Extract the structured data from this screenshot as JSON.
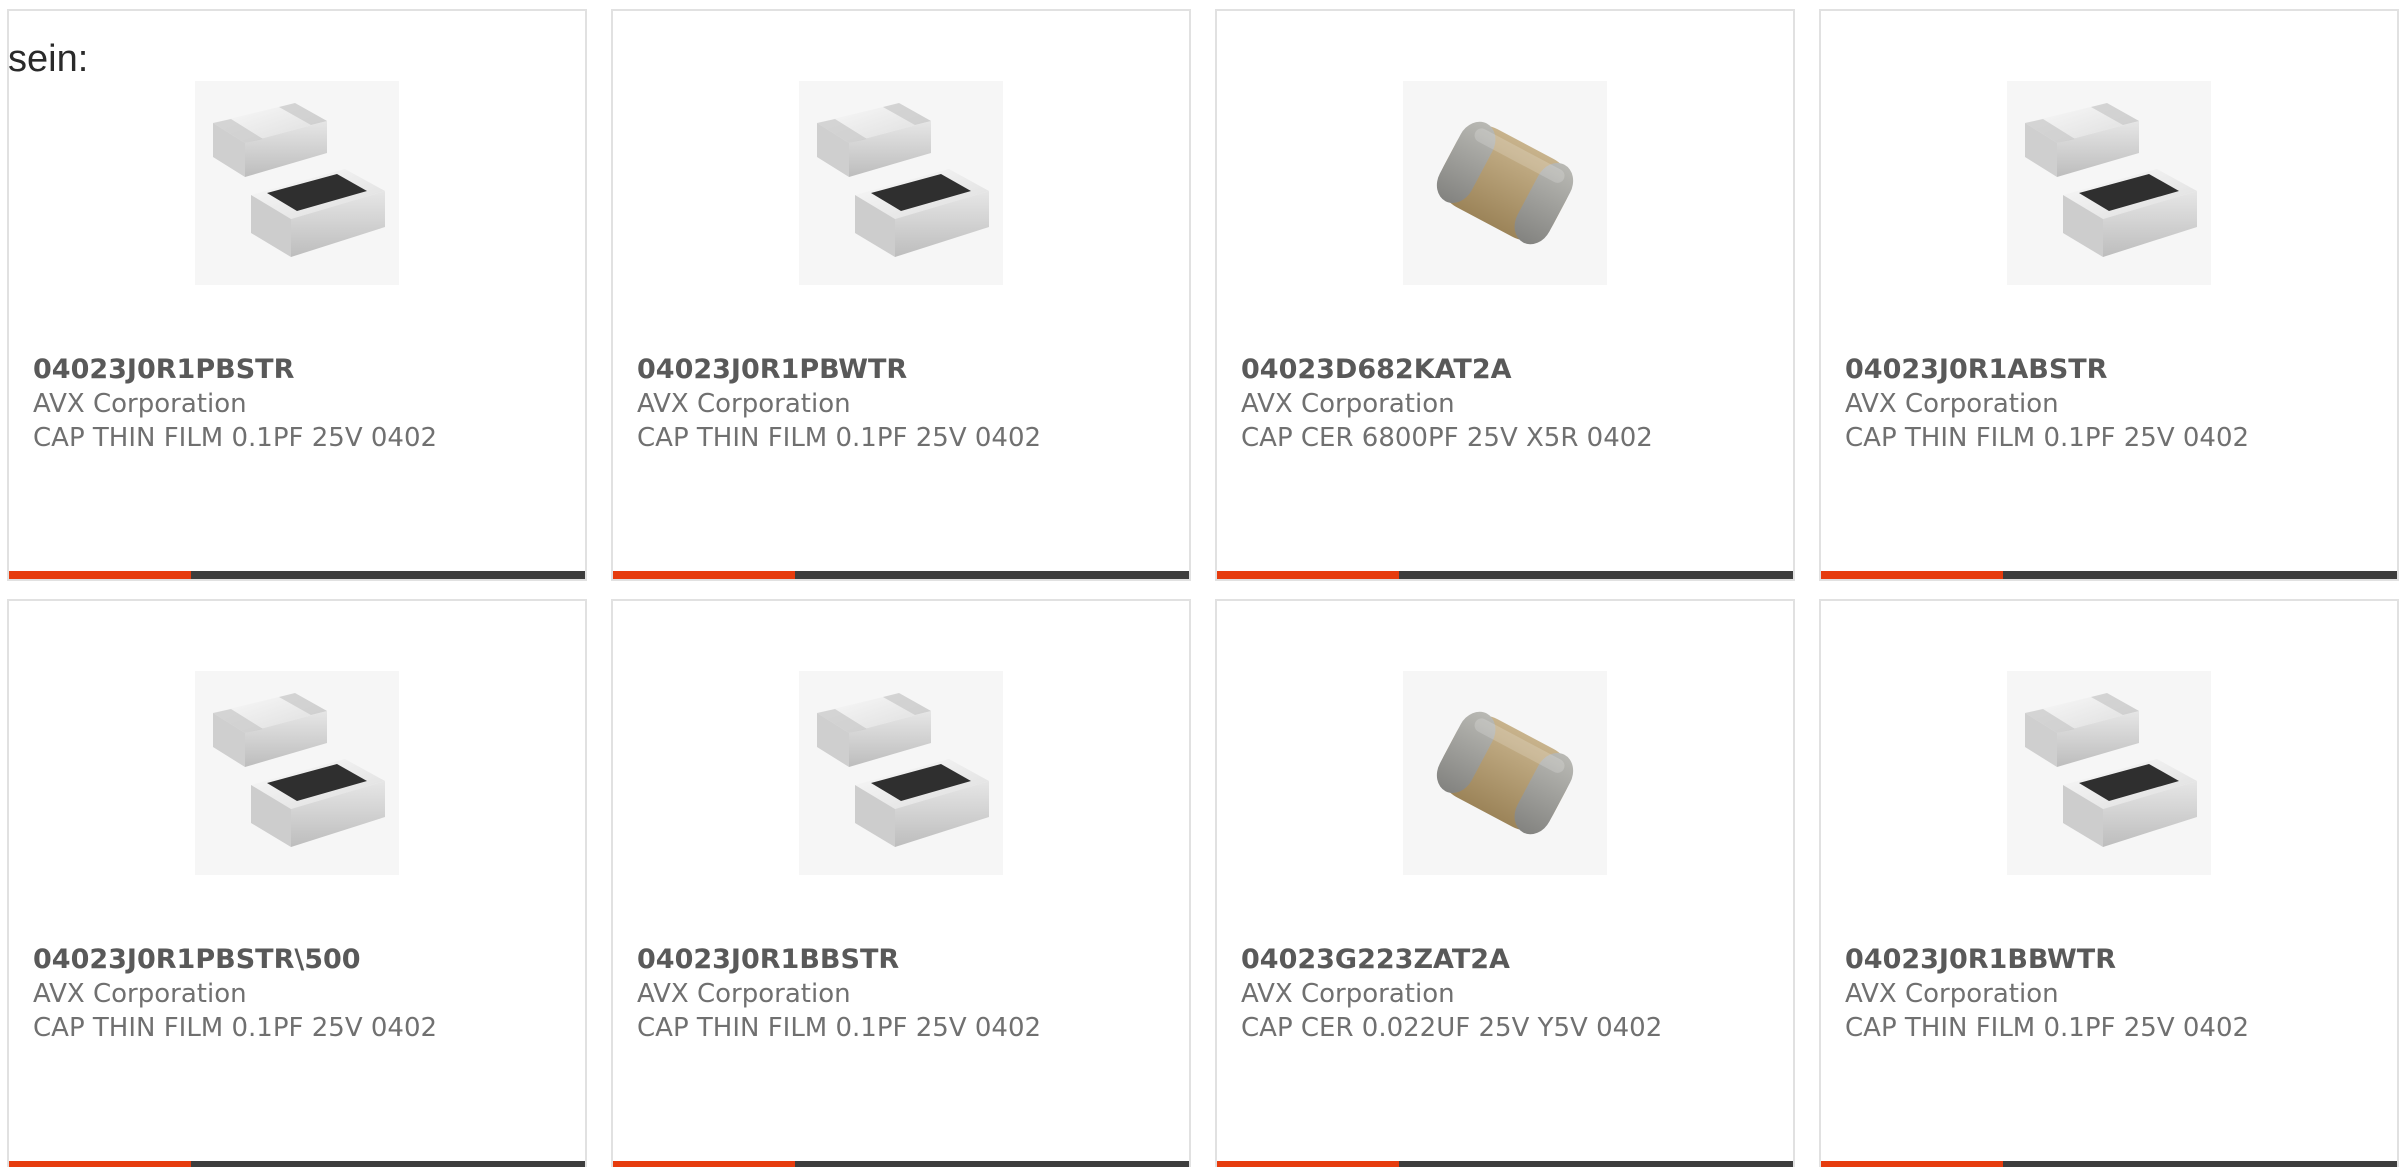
{
  "lead_text": "sein:",
  "colors": {
    "accent": "#e63c0e",
    "bar": "#3d3d3d",
    "border": "#e1e1e1"
  },
  "products": [
    {
      "part_number": "04023J0R1PBSTR",
      "manufacturer": "AVX Corporation",
      "description": "CAP THIN FILM 0.1PF 25V 0402",
      "image": "thin-film-capacitor-image"
    },
    {
      "part_number": "04023J0R1PBWTR",
      "manufacturer": "AVX Corporation",
      "description": "CAP THIN FILM 0.1PF 25V 0402",
      "image": "thin-film-capacitor-image"
    },
    {
      "part_number": "04023D682KAT2A",
      "manufacturer": "AVX Corporation",
      "description": "CAP CER 6800PF 25V X5R 0402",
      "image": "ceramic-capacitor-image"
    },
    {
      "part_number": "04023J0R1ABSTR",
      "manufacturer": "AVX Corporation",
      "description": "CAP THIN FILM 0.1PF 25V 0402",
      "image": "thin-film-capacitor-image"
    },
    {
      "part_number": "04023J0R1PBSTR\\500",
      "manufacturer": "AVX Corporation",
      "description": "CAP THIN FILM 0.1PF 25V 0402",
      "image": "thin-film-capacitor-image"
    },
    {
      "part_number": "04023J0R1BBSTR",
      "manufacturer": "AVX Corporation",
      "description": "CAP THIN FILM 0.1PF 25V 0402",
      "image": "thin-film-capacitor-image"
    },
    {
      "part_number": "04023G223ZAT2A",
      "manufacturer": "AVX Corporation",
      "description": "CAP CER 0.022UF 25V Y5V 0402",
      "image": "ceramic-capacitor-image"
    },
    {
      "part_number": "04023J0R1BBWTR",
      "manufacturer": "AVX Corporation",
      "description": "CAP THIN FILM 0.1PF 25V 0402",
      "image": "thin-film-capacitor-image"
    }
  ]
}
